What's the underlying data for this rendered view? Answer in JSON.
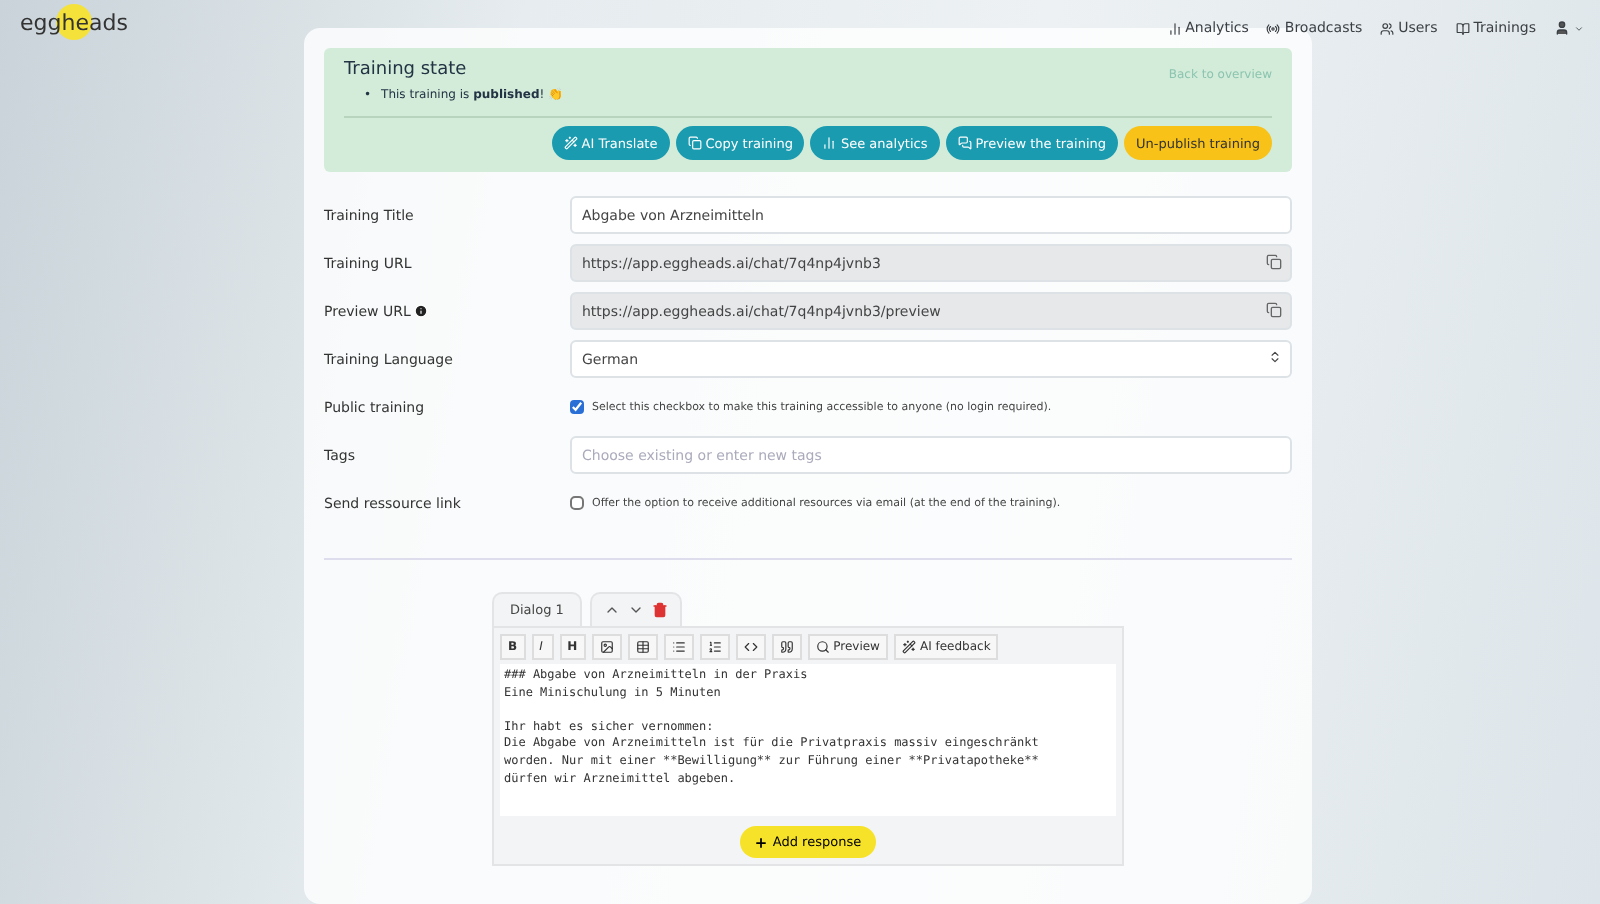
{
  "logo": "eggheads",
  "nav": [
    {
      "label": "Analytics"
    },
    {
      "label": "Broadcasts"
    },
    {
      "label": "Users"
    },
    {
      "label": "Trainings"
    }
  ],
  "state": {
    "title": "Training state",
    "bullet": "•",
    "message": "This training is **published**! 👏",
    "back_link": "Back to overview",
    "actions": [
      {
        "label": "AI Translate",
        "kind": "primary"
      },
      {
        "label": "Copy training",
        "kind": "primary"
      },
      {
        "label": "See analytics",
        "kind": "primary"
      },
      {
        "label": "Preview the training",
        "kind": "primary"
      },
      {
        "label": "Un-publish training",
        "kind": "warning"
      }
    ]
  },
  "fields": [
    {
      "kind": "text",
      "label": "Training Title",
      "value": "Abgabe von Arzneimitteln"
    },
    {
      "kind": "copy",
      "label": "Training URL",
      "value": "https://app.eggheads.ai/chat/7q4np4jvnb3"
    },
    {
      "kind": "copy",
      "label": "Preview URL",
      "info": true,
      "value": "https://app.eggheads.ai/chat/7q4np4jvnb3/preview"
    },
    {
      "kind": "select",
      "label": "Training Language",
      "value": "German"
    },
    {
      "kind": "checkbox",
      "label": "Public training",
      "checked": true,
      "text": "Select this checkbox to make this training accessible to anyone (no login required)."
    },
    {
      "kind": "text",
      "label": "Tags",
      "placeholder": "Choose existing or enter new tags"
    },
    {
      "kind": "checkbox",
      "label": "Send ressource link",
      "checked": false,
      "text": "Offer the option to receive additional resources via email (at the end of the training)."
    }
  ],
  "dialog": {
    "tab": "Dialog 1",
    "toolbar": [
      {
        "kind": "char",
        "label": "B"
      },
      {
        "kind": "char",
        "label": "I"
      },
      {
        "kind": "char",
        "label": "H"
      },
      {
        "kind": "icon"
      },
      {
        "kind": "icon"
      },
      {
        "kind": "icon"
      },
      {
        "kind": "icon"
      },
      {
        "kind": "icon"
      },
      {
        "kind": "icon"
      },
      {
        "kind": "labeled",
        "label": "Preview"
      },
      {
        "kind": "labeled",
        "label": "AI feedback"
      }
    ],
    "content": "### Abgabe von Arzneimitteln in der Praxis\nEine Minischulung in 5 Minuten\n\nIhr habt es sicher vernommen:\nDie Abgabe von Arzneimitteln ist für die Privatpraxis massiv eingeschränkt\nworden. Nur mit einer **Bewilligung** zur Führung einer **Privatapotheke**\ndürfen wir Arzneimittel abgeben.",
    "add_button": "Add response"
  }
}
